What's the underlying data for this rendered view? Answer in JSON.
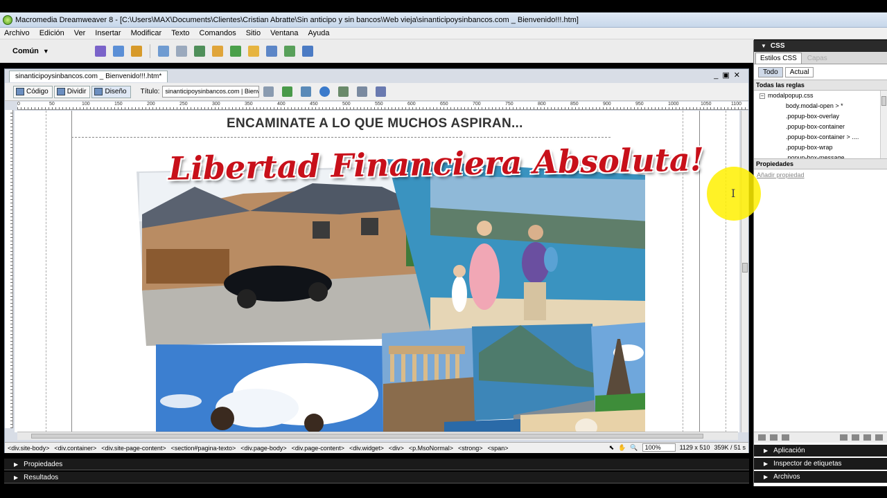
{
  "window": {
    "title": "Macromedia Dreamweaver 8 - [C:\\Users\\MAX\\Documents\\Clientes\\Cristian Abratte\\Sin anticipo y sin bancos\\Web vieja\\sinanticipoysinbancos.com _ Bienvenido!!!.htm]"
  },
  "menu": [
    "Archivo",
    "Edición",
    "Ver",
    "Insertar",
    "Modificar",
    "Texto",
    "Comandos",
    "Sitio",
    "Ventana",
    "Ayuda"
  ],
  "insert_bar": {
    "category": "Común"
  },
  "document": {
    "tab": "sinanticipoysinbancos.com _ Bienvenido!!!.htm*",
    "view_code": "Código",
    "view_split": "Dividir",
    "view_design": "Diseño",
    "title_label": "Título:",
    "title_value": "sinanticipoysinbancos.com | Bienvenido!!!",
    "ruler_ticks": [
      "0",
      "50",
      "100",
      "150",
      "200",
      "250",
      "300",
      "350",
      "400",
      "450",
      "500",
      "550",
      "600",
      "650",
      "700",
      "750",
      "800",
      "850",
      "900",
      "950",
      "1000",
      "1050",
      "1100"
    ]
  },
  "page": {
    "headline": "ENCAMINATE A LO QUE MUCHOS ASPIRAN...",
    "banner": "Libertad Financiera Absoluta!"
  },
  "tag_selector": {
    "tags": [
      "<div.site-body>",
      "<div.container>",
      "<div.site-page-content>",
      "<section#pagina-texto>",
      "<div.page-body>",
      "<div.page-content>",
      "<div.widget>",
      "<div>",
      "<p.MsoNormal>",
      "<strong>",
      "<span>"
    ],
    "zoom": "100%",
    "dimensions": "1129 x 510",
    "size": "359K / 51 s"
  },
  "bottom_panels": {
    "properties": "Propiedades",
    "results": "Resultados"
  },
  "css_panel": {
    "header": "CSS",
    "tab_styles": "Estilos CSS",
    "tab_layers": "Capas",
    "btn_all": "Todo",
    "btn_current": "Actual",
    "all_rules_label": "Todas las reglas",
    "stylesheet": "modalpopup.css",
    "rules": [
      "body.modal-open > *",
      ".popup-box-overlay",
      ".popup-box-container",
      ".popup-box-container > ....",
      ".popup-box-wrap",
      ".popup-box-message"
    ],
    "properties_label": "Propiedades",
    "add_property": "Añadir propiedad"
  },
  "side_panels": {
    "application": "Aplicación",
    "tag_inspector": "Inspector de etiquetas",
    "files": "Archivos"
  }
}
